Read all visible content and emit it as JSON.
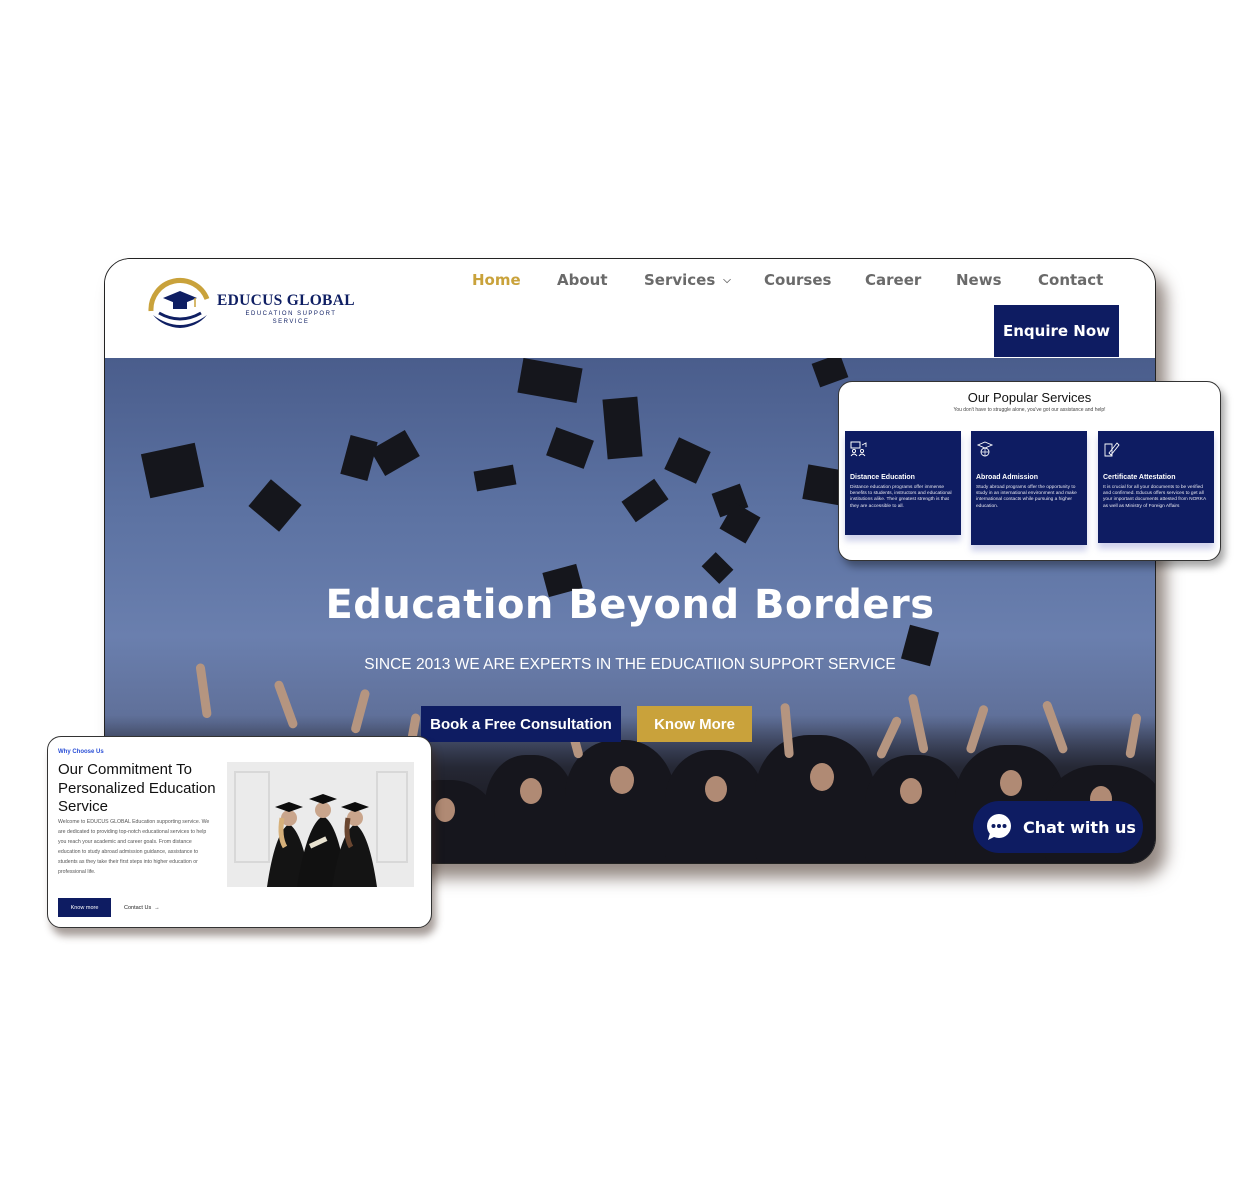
{
  "brand": {
    "name": "EDUCUS GLOBAL",
    "tagline": "EDUCATION SUPPORT SERVICE",
    "navy": "#0e1c62",
    "gold": "#c9a23b"
  },
  "nav": {
    "items": [
      {
        "label": "Home",
        "active": true
      },
      {
        "label": "About"
      },
      {
        "label": "Services",
        "dropdown": true
      },
      {
        "label": "Courses"
      },
      {
        "label": "Career"
      },
      {
        "label": "News"
      },
      {
        "label": "Contact"
      }
    ],
    "cta": "Enquire Now"
  },
  "hero": {
    "title": "Education Beyond Borders",
    "subtitle": "SINCE 2013 WE ARE EXPERTS IN THE EDUCATIION SUPPORT SERVICE",
    "primary_button": "Book a Free Consultation",
    "secondary_button": "Know More"
  },
  "chat": {
    "label": "Chat with us",
    "icon": "chat-bubble-icon"
  },
  "services": {
    "title": "Our Popular Services",
    "subtitle": "You don't have to struggle alone, you've got our assistance and help!",
    "items": [
      {
        "name": "Distance Education",
        "icon": "classroom-icon",
        "desc": "Distance education programs offer immense benefits to students, instructors and educational institutions alike. Their greatest strength is that they are accessible to all."
      },
      {
        "name": "Abroad Admission",
        "icon": "graduation-globe-icon",
        "desc": "Study abroad programs offer the opportunity to study in an international environment and make international contacts while pursuing a higher education."
      },
      {
        "name": "Certificate Attestation",
        "icon": "document-pen-icon",
        "desc": "It is crucial for all your documents to be verified and confirmed. Educus offers services to get all your important documents attested from NORKA as well as Ministry of Foreign Affairs"
      }
    ]
  },
  "why": {
    "eyebrow": "Why Choose Us",
    "title": "Our Commitment To Personalized Education Service",
    "body": "Welcome to EDUCUS GLOBAL Education supporting service. We are dedicated to providing top-notch educational services to help you reach your academic and career goals. From distance education to study abroad admission guidance, assistance to students as they take their first steps into higher education or professional life.",
    "button": "Know more",
    "link": "Contact Us",
    "link_icon": "arrow-right-icon"
  }
}
